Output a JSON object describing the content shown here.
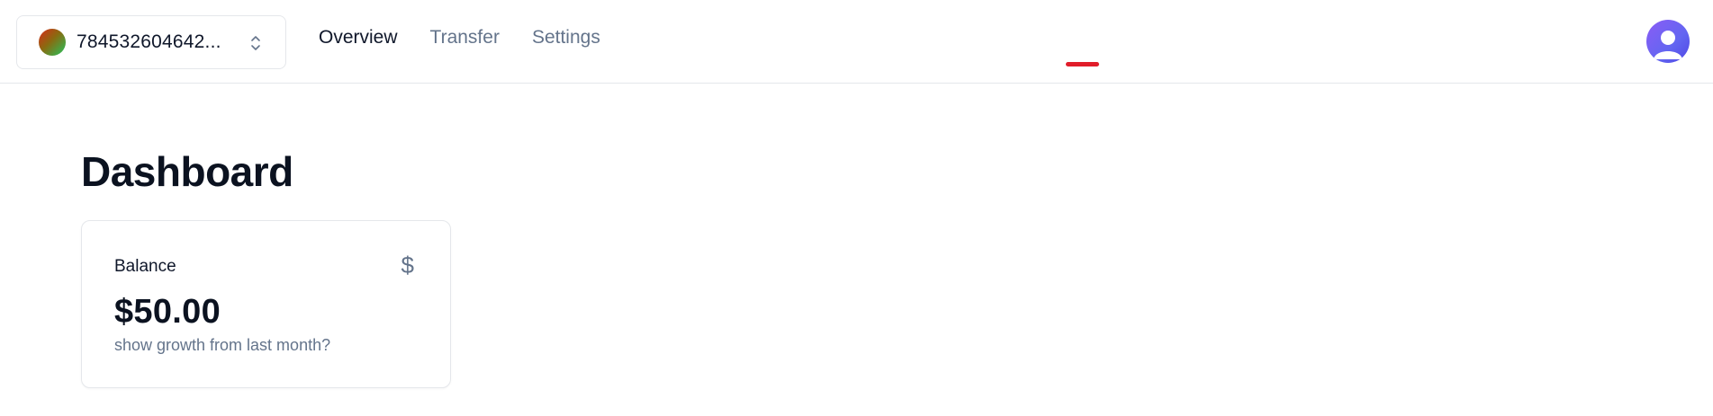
{
  "header": {
    "account": {
      "id": "784532604642...",
      "avatar_icon": "account-gradient-avatar"
    },
    "nav": {
      "items": [
        {
          "label": "Overview",
          "active": true
        },
        {
          "label": "Transfer",
          "active": false
        },
        {
          "label": "Settings",
          "active": false
        }
      ]
    },
    "user_avatar_icon": "user-avatar-icon"
  },
  "main": {
    "title": "Dashboard",
    "balance_card": {
      "label": "Balance",
      "icon": "dollar-icon",
      "currency_symbol": "$",
      "value": "$50.00",
      "subtitle": "show growth from last month?"
    }
  },
  "colors": {
    "accent_marker": "#e11d2a",
    "muted_text": "#64748b",
    "primary_text": "#0f172a",
    "avatar_purple": "#6366f1"
  }
}
